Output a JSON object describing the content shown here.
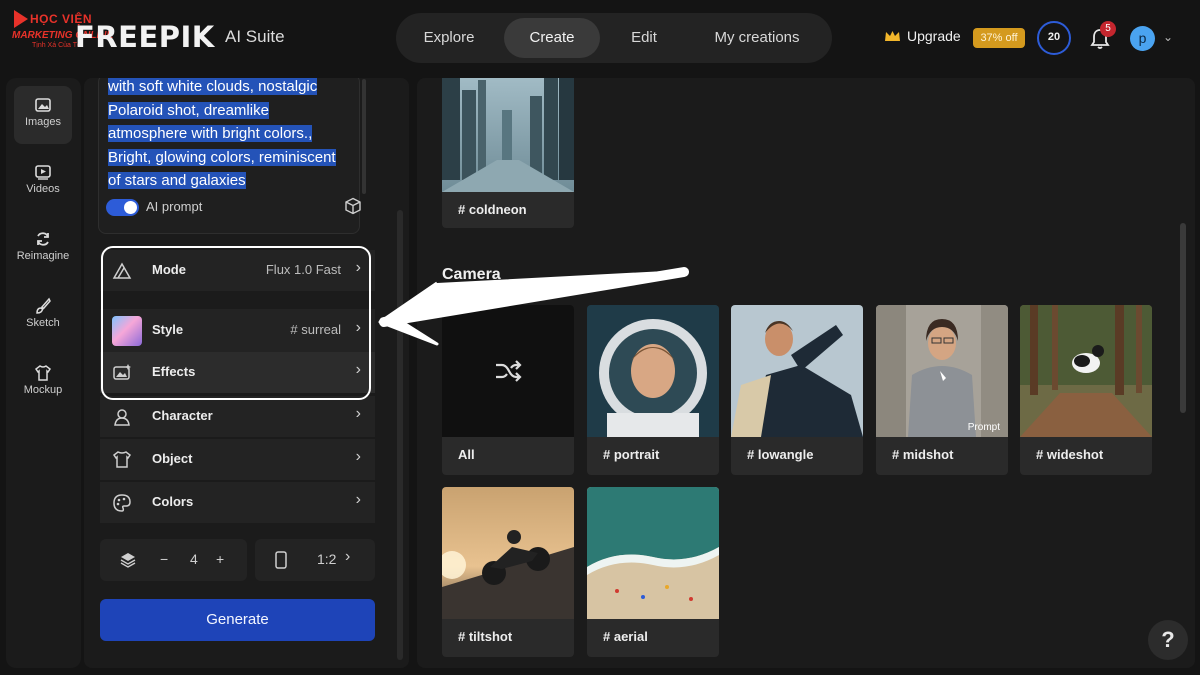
{
  "watermark": {
    "line1": "HỌC VIỆN",
    "line2": "MARKETING ONLINE",
    "line3": "Tịnh Xá Của Tôi"
  },
  "header": {
    "brand": "FREEPIK",
    "suite": "AI Suite",
    "tabs": [
      {
        "label": "Explore",
        "active": false
      },
      {
        "label": "Create",
        "active": true
      },
      {
        "label": "Edit",
        "active": false
      },
      {
        "label": "My creations",
        "active": false
      }
    ],
    "upgrade_label": "Upgrade",
    "discount": "37% off",
    "credits": "20",
    "notifications": "5",
    "avatar_initial": "p"
  },
  "rail": [
    {
      "label": "Images",
      "icon": "image-icon",
      "active": true
    },
    {
      "label": "Videos",
      "icon": "video-icon",
      "active": false
    },
    {
      "label": "Reimagine",
      "icon": "refresh-icon",
      "active": false
    },
    {
      "label": "Sketch",
      "icon": "brush-icon",
      "active": false
    },
    {
      "label": "Mockup",
      "icon": "shirt-icon",
      "active": false
    }
  ],
  "prompt": {
    "text_lines": [
      "with soft white clouds, nostalgic",
      "Polaroid shot, dreamlike",
      "atmosphere with bright colors.,",
      "Bright, glowing colors, reminiscent",
      "of stars and galaxies"
    ],
    "ai_prompt_label": "AI prompt",
    "ai_prompt_on": true
  },
  "options": [
    {
      "label": "Mode",
      "value": "Flux 1.0 Fast",
      "icon": "mode-icon"
    },
    {
      "label": "Style",
      "value": "# surreal",
      "icon": "style-thumbnail"
    },
    {
      "label": "Effects",
      "value": "",
      "icon": "effects-icon"
    },
    {
      "label": "Character",
      "value": "",
      "icon": "character-icon"
    },
    {
      "label": "Object",
      "value": "",
      "icon": "object-icon"
    },
    {
      "label": "Colors",
      "value": "",
      "icon": "palette-icon"
    }
  ],
  "count": {
    "minus": "−",
    "value": "4",
    "plus": "+"
  },
  "aspect": "1:2",
  "generate_label": "Generate",
  "gallery": {
    "top_card": "# coldneon",
    "section": "Camera",
    "cards": [
      {
        "label": "All"
      },
      {
        "label": "# portrait"
      },
      {
        "label": "# lowangle"
      },
      {
        "label": "# midshot",
        "chip": "Prompt"
      },
      {
        "label": "# wideshot"
      },
      {
        "label": "# tiltshot"
      },
      {
        "label": "# aerial"
      }
    ]
  },
  "help": "?"
}
